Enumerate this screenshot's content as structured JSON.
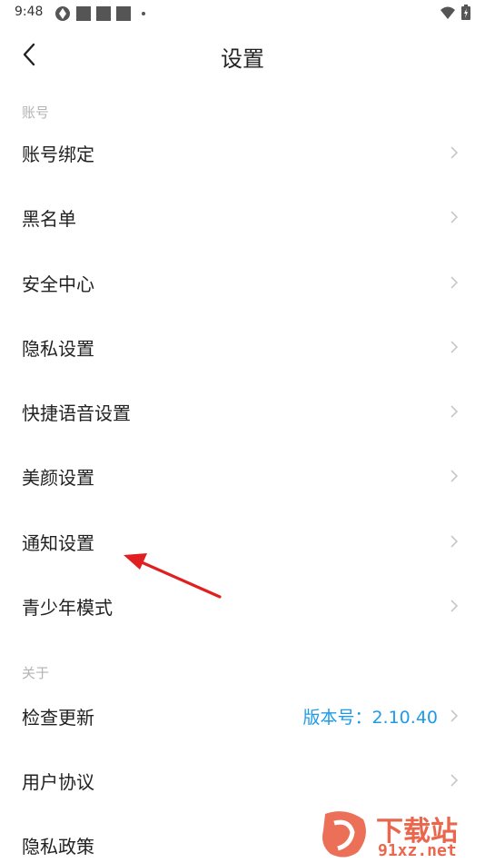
{
  "status": {
    "time": "9:48"
  },
  "header": {
    "title": "设置"
  },
  "sections": {
    "account": "账号",
    "about": "关于"
  },
  "rows": {
    "account_binding": "账号绑定",
    "blacklist": "黑名单",
    "security_center": "安全中心",
    "privacy_settings": "隐私设置",
    "quick_voice": "快捷语音设置",
    "beauty": "美颜设置",
    "notification": "通知设置",
    "teen_mode": "青少年模式",
    "check_update": "检查更新",
    "version_value": "版本号：2.10.40",
    "user_agreement": "用户协议",
    "privacy_policy": "隐私政策"
  },
  "watermark": {
    "brand": "下载站",
    "domain": "91xz.net"
  },
  "colors": {
    "accent": "#1e9be8",
    "arrow": "#e02020",
    "label_gray": "#b3b3b3",
    "chevron": "#c8c8c8"
  }
}
